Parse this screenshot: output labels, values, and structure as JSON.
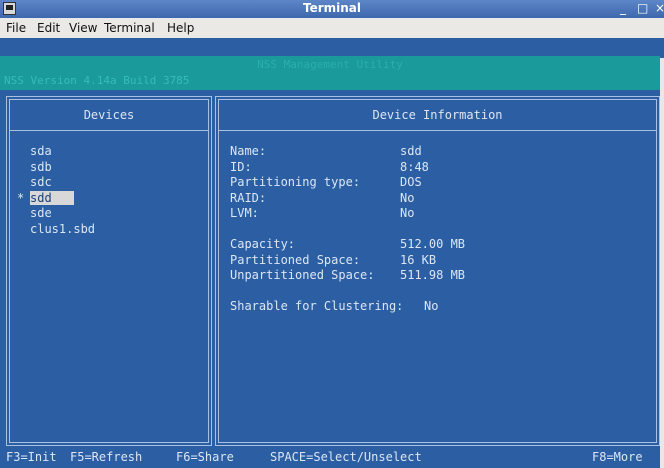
{
  "window": {
    "title": "Terminal",
    "minimize_glyph": "_",
    "maximize_glyph": "□",
    "close_glyph": "×"
  },
  "menu": [
    "File",
    "Edit",
    "View",
    "Terminal",
    "Help"
  ],
  "header": {
    "title": "NSS Management Utility",
    "version": "NSS Version 4.14a  Build 3785"
  },
  "devices_panel": {
    "title": "Devices",
    "marker": "*",
    "items": [
      "sda",
      "sdb",
      "sdc",
      "sdd",
      "sde",
      "clus1.sbd"
    ],
    "selected": "sdd"
  },
  "info_panel": {
    "title": "Device Information",
    "name": {
      "label": "Name:",
      "value": "sdd"
    },
    "id": {
      "label": "ID:",
      "value": "8:48"
    },
    "partitioning": {
      "label": "Partitioning type:",
      "value": "DOS"
    },
    "raid": {
      "label": "RAID:",
      "value": "No"
    },
    "lvm": {
      "label": "LVM:",
      "value": "No"
    },
    "capacity": {
      "label": "Capacity:",
      "value": "512.00 MB"
    },
    "partitioned": {
      "label": "Partitioned Space:",
      "value": "16 KB"
    },
    "unpartitioned": {
      "label": "Unpartitioned Space:",
      "value": "511.98 MB"
    },
    "sharable": {
      "label": "Sharable for Clustering:",
      "value": "No"
    }
  },
  "footer": {
    "init": "F3=Init",
    "refresh": "F5=Refresh",
    "share": "F6=Share",
    "select": "SPACE=Select/Unselect",
    "more": "F8=More"
  },
  "colors": {
    "background": "#2b5ea3",
    "header": "#1a9a9a",
    "text": "#dce6f5",
    "selection": "#d8d8d8"
  }
}
